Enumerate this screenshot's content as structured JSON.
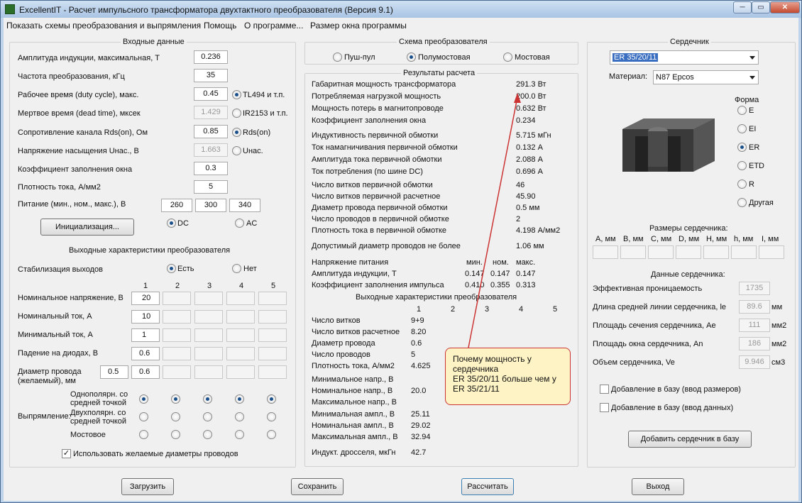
{
  "window": {
    "title": "ExcellentIT - Расчет импульсного трансформатора двухтактного преобразователя (Версия 9.1)",
    "min": "─",
    "max": "▭",
    "close": "✕"
  },
  "menu": [
    "Показать схемы преобразования и выпрямления",
    "Помощь",
    "О программе...",
    "Размер окна программы"
  ],
  "input": {
    "title": "Входные данные",
    "induction": {
      "label": "Амплитуда индукции, максимальная, Т",
      "value": "0.236"
    },
    "freq": {
      "label": "Частота преобразования, кГц",
      "value": "35"
    },
    "duty": {
      "label": "Рабочее время (duty cycle), макс.",
      "value": "0.45"
    },
    "dead": {
      "label": "Мертвое время (dead time), мксек",
      "value": "1.429"
    },
    "rds": {
      "label": "Сопротивление канала Rds(on), Ом",
      "value": "0.85"
    },
    "usat": {
      "label": "Напряжение насыщения Uнас., В",
      "value": "1.663"
    },
    "fill": {
      "label": "Коэффициент заполнения окна",
      "value": "0.3"
    },
    "density": {
      "label": "Плотность тока, А/мм2",
      "value": "5"
    },
    "supply": {
      "label": "Питание (мин., ном., макс.), В",
      "values": [
        "260",
        "300",
        "340"
      ]
    },
    "radio_tl494": "TL494 и т.п.",
    "radio_ir2153": "IR2153 и т.п.",
    "radio_rds": "Rds(on)",
    "radio_unas": "Uнас.",
    "init_button": "Инициализация...",
    "dc": "DC",
    "ac": "AC"
  },
  "output": {
    "title": "Выходные характеристики преобразователя",
    "stab_label": "Стабилизация выходов",
    "yes": "Есть",
    "no": "Нет",
    "cols": [
      "1",
      "2",
      "3",
      "4",
      "5"
    ],
    "nom_v": {
      "label": "Номинальное напряжение, В",
      "value": "20"
    },
    "nom_i": {
      "label": "Номинальный ток, А",
      "value": "10"
    },
    "min_i": {
      "label": "Минимальный ток, А",
      "value": "1"
    },
    "diode": {
      "label": "Падение на диодах, В",
      "value": "0.6"
    },
    "wire": {
      "label": "Диаметр провода",
      "label2": "(желаемый), мм",
      "v1": "0.5",
      "v2": "0.6"
    },
    "rect_label": "Выпрямление:",
    "rect1a": "Однополярн. со",
    "rect1b": "средней точкой",
    "rect2a": "Двухполярн. со",
    "rect2b": "средней точкой",
    "rect3": "Мостовое",
    "use_wire": "Использовать желаемые диаметры проводов"
  },
  "scheme": {
    "title": "Схема преобразователя",
    "pp": "Пуш-пул",
    "half": "Полумостовая",
    "bridge": "Мостовая"
  },
  "results": {
    "title": "Результаты расчета",
    "rows1": [
      [
        "Габаритная мощность трансформатора",
        "291.3 Вт"
      ],
      [
        "Потребляемая нагрузкой мощность",
        "200.0 Вт"
      ],
      [
        "Мощность потерь в магнитопроводе",
        "0.632 Вт"
      ],
      [
        "Коэффициент заполнения окна",
        "0.234"
      ]
    ],
    "rows2": [
      [
        "Индуктивность первичной обмотки",
        "5.715 мГн"
      ],
      [
        "Ток намагничивания первичной обмотки",
        "0.132 А"
      ],
      [
        "Амплитуда тока первичной обмотки",
        "2.088 А"
      ],
      [
        "Ток потребления (по шине DC)",
        "0.696 А"
      ]
    ],
    "rows3": [
      [
        "Число витков первичной обмотки",
        "46"
      ],
      [
        "Число витков первичной расчетное",
        "45.90"
      ],
      [
        "Диаметр провода первичной обмотки",
        "0.5 мм"
      ],
      [
        "Число проводов в первичной обмотке",
        "2"
      ],
      [
        "Плотность тока в первичной обмотке",
        "4.198 А/мм2"
      ]
    ],
    "rows4": [
      [
        "Допустимый диаметр проводов не более",
        "1.06 мм"
      ]
    ],
    "supply_label": "Напряжение питания",
    "min": "мин.",
    "nom": "ном.",
    "max": "макс.",
    "ind_label": "Амплитуда индукции, Т",
    "ind": [
      "0.147",
      "0.147",
      "0.147"
    ],
    "duty_label": "Коэффициент заполнения импульса",
    "duty": [
      "0.410",
      "0.355",
      "0.313"
    ],
    "out_title": "Выходные характеристики преобразователя",
    "out_cols": [
      "1",
      "2",
      "3",
      "4",
      "5"
    ],
    "out_rows": [
      [
        "Число витков",
        "9+9"
      ],
      [
        "Число витков расчетное",
        "8.20"
      ],
      [
        "Диаметр провода",
        "0.6"
      ],
      [
        "Число проводов",
        "5"
      ],
      [
        "Плотность тока, А/мм2",
        "4.625"
      ]
    ],
    "out_rows2": [
      [
        "Минимальное напр., В",
        ""
      ],
      [
        "Номинальное напр., В",
        "20.0"
      ],
      [
        "Максимальное напр., В",
        ""
      ]
    ],
    "out_rows3": [
      [
        "Минимальная ампл., В",
        "25.11"
      ],
      [
        "Номинальная ампл., В",
        "29.02"
      ],
      [
        "Максимальная ампл., В",
        "32.94"
      ]
    ],
    "out_rows4": [
      [
        "Индукт. дросселя, мкГн",
        "42.7"
      ]
    ]
  },
  "core": {
    "title": "Сердечник",
    "selected": "ER 35/20/11",
    "material_label": "Материал:",
    "material": "N87 Epcos",
    "shape_label": "Форма",
    "shapes": [
      "E",
      "EI",
      "ER",
      "ETD",
      "R",
      "Другая"
    ],
    "dims_title": "Размеры сердечника:",
    "dims": [
      "A, мм",
      "B, мм",
      "C, мм",
      "D, мм",
      "H, мм",
      "h, мм",
      "I, мм"
    ],
    "data_title": "Данные сердечника:",
    "data": [
      [
        "Эффективная проницаемость",
        "1735",
        ""
      ],
      [
        "Длина средней линии сердечника, le",
        "89.6",
        "мм"
      ],
      [
        "Площадь сечения сердечника, Ae",
        "111",
        "мм2"
      ],
      [
        "Площадь окна сердечника, An",
        "186",
        "мм2"
      ],
      [
        "Объем сердечника, Ve",
        "9.946",
        "см3"
      ]
    ],
    "add_dims": "Добавление в базу (ввод размеров)",
    "add_data": "Добавление в базу (ввод данных)",
    "add_button": "Добавить сердечник в базу"
  },
  "callout": {
    "lines": [
      "Почему мощность у",
      "сердечника",
      "ER 35/20/11 больше чем у",
      "ER 35/21/11"
    ]
  },
  "buttons": {
    "load": "Загрузить",
    "save": "Сохранить",
    "calc": "Рассчитать",
    "exit": "Выход"
  }
}
